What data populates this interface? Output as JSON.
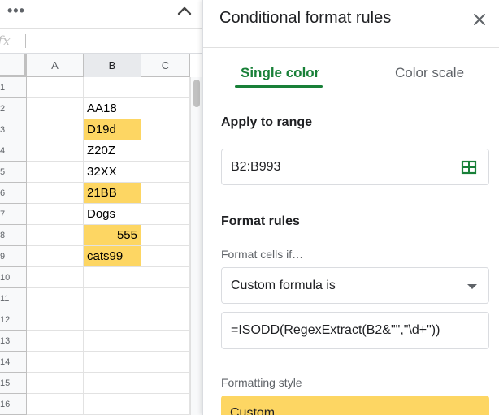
{
  "toolbar": {
    "menu_glyph": "•••",
    "fx_label": "fx"
  },
  "sheet": {
    "columns": [
      "A",
      "B",
      "C"
    ],
    "selected_column": "B",
    "rows": [
      {
        "num": "1",
        "b": "",
        "highlight": false,
        "numeric": false
      },
      {
        "num": "2",
        "b": "AA18",
        "highlight": false,
        "numeric": false
      },
      {
        "num": "3",
        "b": "D19d",
        "highlight": true,
        "numeric": false
      },
      {
        "num": "4",
        "b": "Z20Z",
        "highlight": false,
        "numeric": false
      },
      {
        "num": "5",
        "b": "32XX",
        "highlight": false,
        "numeric": false
      },
      {
        "num": "6",
        "b": "21BB",
        "highlight": true,
        "numeric": false
      },
      {
        "num": "7",
        "b": "Dogs",
        "highlight": false,
        "numeric": false
      },
      {
        "num": "8",
        "b": "555",
        "highlight": true,
        "numeric": true
      },
      {
        "num": "9",
        "b": "cats99",
        "highlight": true,
        "numeric": false
      },
      {
        "num": "10",
        "b": "",
        "highlight": false,
        "numeric": false
      },
      {
        "num": "11",
        "b": "",
        "highlight": false,
        "numeric": false
      },
      {
        "num": "12",
        "b": "",
        "highlight": false,
        "numeric": false
      },
      {
        "num": "13",
        "b": "",
        "highlight": false,
        "numeric": false
      },
      {
        "num": "14",
        "b": "",
        "highlight": false,
        "numeric": false
      },
      {
        "num": "15",
        "b": "",
        "highlight": false,
        "numeric": false
      },
      {
        "num": "16",
        "b": "",
        "highlight": false,
        "numeric": false
      }
    ]
  },
  "panel": {
    "title": "Conditional format rules",
    "tabs": {
      "single": "Single color",
      "scale": "Color scale"
    },
    "apply_to_range_label": "Apply to range",
    "range_value": "B2:B993",
    "format_rules_label": "Format rules",
    "format_cells_if_label": "Format cells if…",
    "condition_value": "Custom formula is",
    "formula_value": "=ISODD(RegexExtract(B2&\"\",\"\\d+\"))",
    "formatting_style_label": "Formatting style",
    "style_preview_label": "Custom"
  },
  "colors": {
    "highlight": "#fdd663",
    "accent_green": "#188038"
  }
}
